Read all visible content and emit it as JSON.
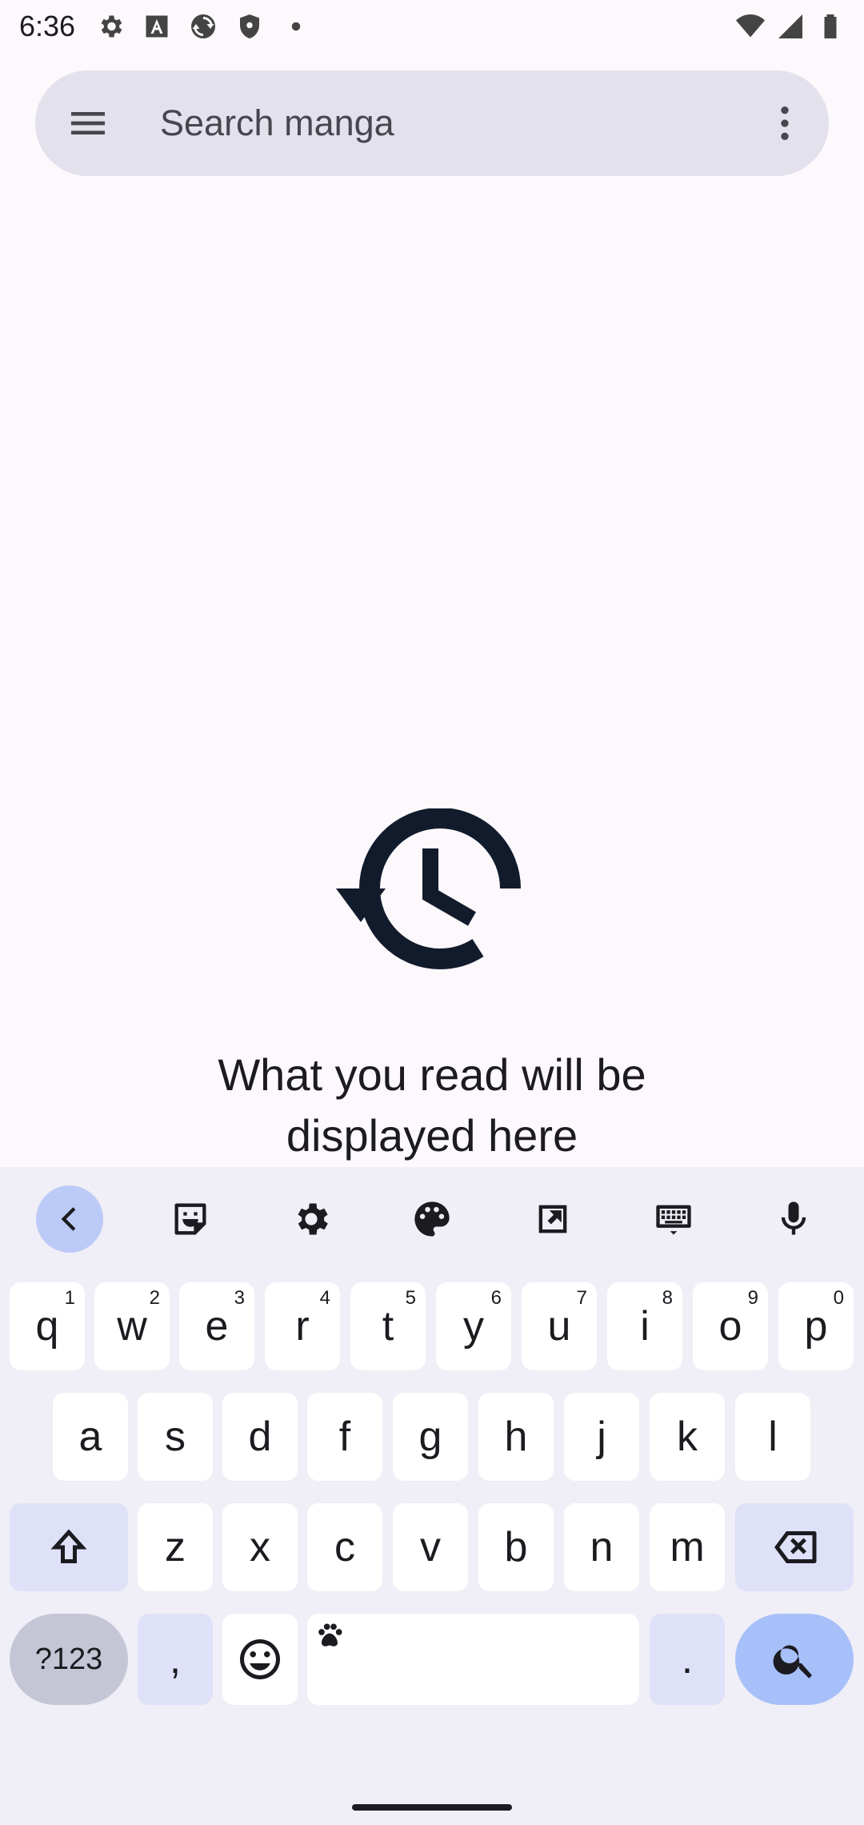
{
  "status_bar": {
    "time": "6:36",
    "icons_left": [
      "settings-icon",
      "font-a-icon",
      "sync-icon",
      "shield-icon",
      "dot-icon"
    ],
    "icons_right": [
      "wifi-icon",
      "signal-icon",
      "battery-icon"
    ]
  },
  "search": {
    "placeholder": "Search manga"
  },
  "empty_state": {
    "icon": "history-icon",
    "message": "What you read will be displayed here"
  },
  "keyboard": {
    "toolbar": [
      "back-icon",
      "sticker-icon",
      "settings-icon",
      "palette-icon",
      "resize-icon",
      "keyboard-icon",
      "mic-icon"
    ],
    "row1": [
      {
        "label": "q",
        "hint": "1"
      },
      {
        "label": "w",
        "hint": "2"
      },
      {
        "label": "e",
        "hint": "3"
      },
      {
        "label": "r",
        "hint": "4"
      },
      {
        "label": "t",
        "hint": "5"
      },
      {
        "label": "y",
        "hint": "6"
      },
      {
        "label": "u",
        "hint": "7"
      },
      {
        "label": "i",
        "hint": "8"
      },
      {
        "label": "o",
        "hint": "9"
      },
      {
        "label": "p",
        "hint": "0"
      }
    ],
    "row2": [
      "a",
      "s",
      "d",
      "f",
      "g",
      "h",
      "j",
      "k",
      "l"
    ],
    "row3": [
      "z",
      "x",
      "c",
      "v",
      "b",
      "n",
      "m"
    ],
    "symbols_label": "?123",
    "comma_label": ",",
    "period_label": "."
  }
}
